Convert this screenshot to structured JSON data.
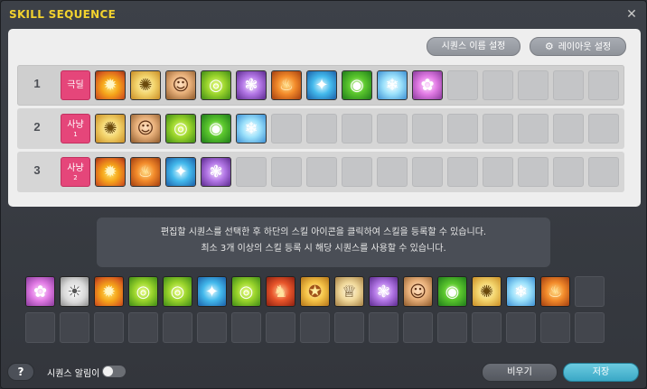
{
  "window": {
    "title": "SKILL SEQUENCE",
    "close_glyph": "✕"
  },
  "top_buttons": {
    "rename": "시퀀스 이름 설정",
    "layout": "레이아웃 설정",
    "layout_icon": "gear-icon"
  },
  "sequences": [
    {
      "number": "1",
      "badge": "극딜",
      "badge_sub": "",
      "skills": [
        "fire",
        "gold",
        "face",
        "green",
        "purple",
        "orange",
        "blue",
        "eye",
        "ice",
        "pink"
      ],
      "total_slots": 15
    },
    {
      "number": "2",
      "badge": "사냥",
      "badge_sub": "1",
      "skills": [
        "gold",
        "face",
        "green",
        "eye",
        "ice"
      ],
      "total_slots": 15
    },
    {
      "number": "3",
      "badge": "사냥",
      "badge_sub": "2",
      "skills": [
        "fire",
        "orange",
        "blue",
        "purple"
      ],
      "total_slots": 15
    }
  ],
  "info": {
    "line1": "편집할 시퀀스를 선택한 후 하단의 스킬 아이콘을 클릭하여 스킬을 등록할 수 있습니다.",
    "line2": "최소 3개 이상의 스킬 등록 시 해당 시퀀스를 사용할 수 있습니다."
  },
  "palette": {
    "row1": [
      "pink",
      "white",
      "fire",
      "green",
      "green",
      "blue",
      "green",
      "red",
      "sun",
      "sage",
      "purple",
      "face",
      "eye",
      "gold",
      "ice",
      "orange"
    ],
    "row1_total": 17,
    "row2_total": 17
  },
  "footer": {
    "help": "?",
    "notify_label": "시퀀스 알림이",
    "notify_on": false,
    "clear": "비우기",
    "save": "저장"
  },
  "colors": {
    "title": "#f2d22e",
    "badge": "#e5467a",
    "save_button": "#3aa8c6"
  }
}
